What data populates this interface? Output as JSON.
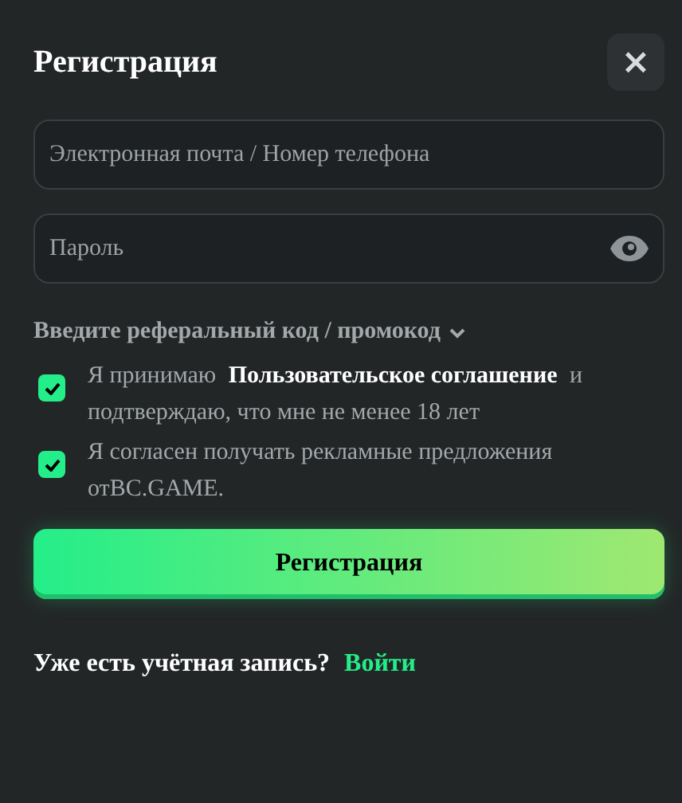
{
  "title": "Регистрация",
  "close_label": "×",
  "email_field": {
    "placeholder": "Электронная почта / Номер телефона"
  },
  "password_field": {
    "placeholder": "Пароль"
  },
  "referral": {
    "label": "Введите реферальный код / промокод",
    "expanded": false
  },
  "consents": [
    {
      "kind": "link",
      "checked": true,
      "before": "Я принимаю ",
      "link": "Пользовательское соглашение",
      "after": " и подтверждаю, что мне не менее 18 лет"
    },
    {
      "kind": "plain",
      "checked": true,
      "text": "Я согласен получать рекламные предложения отBC.GAME."
    }
  ],
  "submit": "Регистрация",
  "footer": {
    "question": "Уже есть учётная запись?",
    "link": "Войти"
  }
}
